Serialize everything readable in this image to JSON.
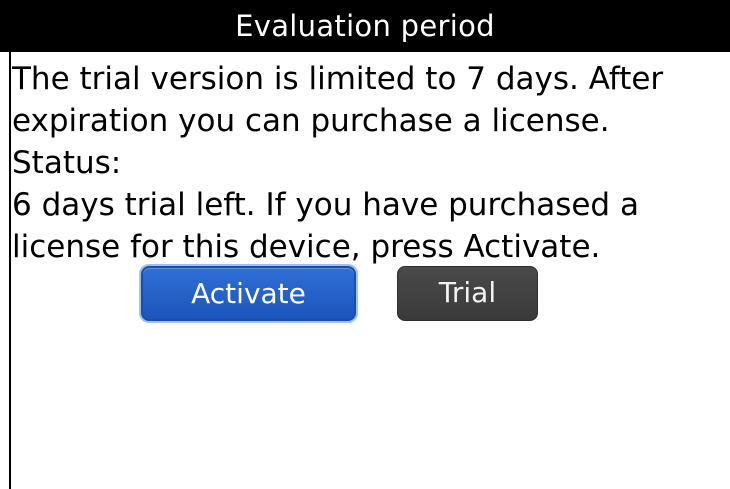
{
  "dialog": {
    "title": "Evaluation period",
    "lines": [
      "The trial version is limited to 7 days. After",
      "expiration you can purchase a license.",
      "Status:",
      "6 days trial left. If you have purchased a",
      "license for this device, press Activate."
    ],
    "buttons": {
      "activate_label": "Activate",
      "trial_label": "Trial"
    }
  },
  "colors": {
    "title_bar_bg": "#000000",
    "title_text": "#ffffff",
    "activate_button_bg": "#1f5fc8",
    "trial_button_bg": "#404040"
  }
}
